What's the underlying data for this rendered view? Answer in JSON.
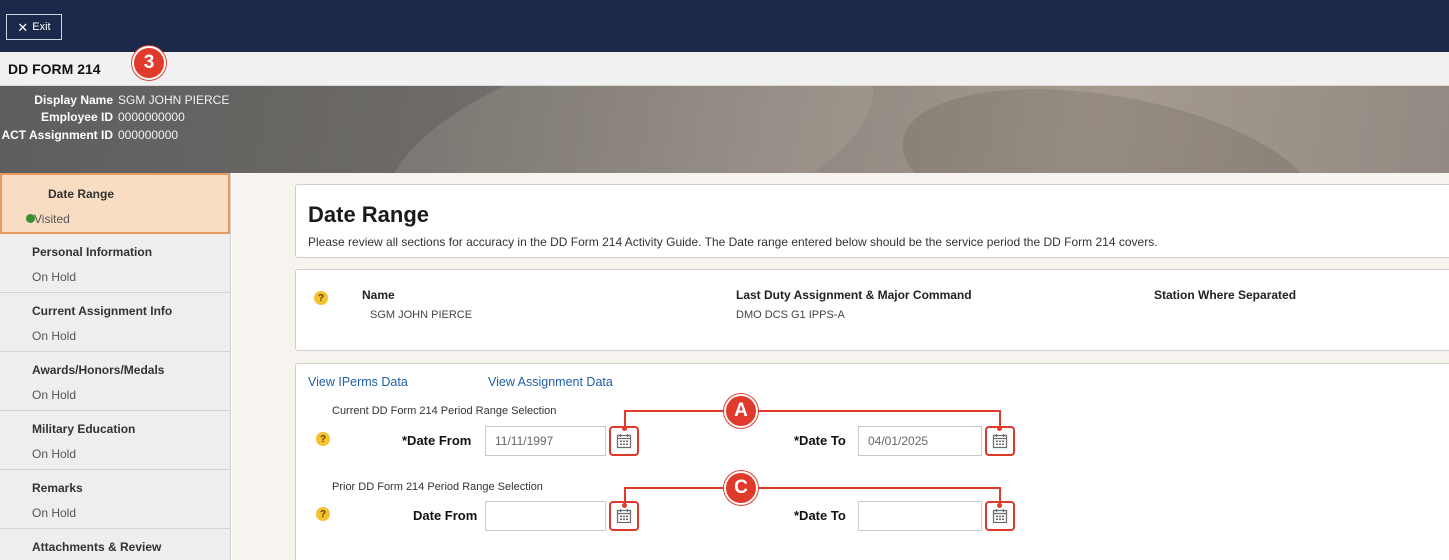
{
  "topbar": {
    "exit_label": "Exit"
  },
  "header": {
    "form_title": "DD FORM 214"
  },
  "callouts": {
    "step": "3",
    "a": "A",
    "c": "C"
  },
  "banner": {
    "display_name_label": "Display Name",
    "display_name_value": "SGM JOHN PIERCE",
    "employee_id_label": "Employee ID",
    "employee_id_value": "0000000000",
    "assignment_id_label": "ACT Assignment ID",
    "assignment_id_value": "000000000"
  },
  "sidebar": {
    "items": [
      {
        "title": "Date Range",
        "status": "Visited"
      },
      {
        "title": "Personal Information",
        "status": "On Hold"
      },
      {
        "title": "Current Assignment Info",
        "status": "On Hold"
      },
      {
        "title": "Awards/Honors/Medals",
        "status": "On Hold"
      },
      {
        "title": "Military Education",
        "status": "On Hold"
      },
      {
        "title": "Remarks",
        "status": "On Hold"
      },
      {
        "title": "Attachments & Review",
        "status": ""
      }
    ]
  },
  "main": {
    "heading": "Date Range",
    "description": "Please review all sections for accuracy in the DD Form 214 Activity Guide. The Date range entered below should be the service period the DD Form 214 covers.",
    "summary": {
      "help": "?",
      "name_header": "Name",
      "name_value": "SGM JOHN PIERCE",
      "duty_header": "Last Duty Assignment & Major Command",
      "duty_value": "DMO DCS G1 IPPS-A",
      "station_header": "Station Where Separated",
      "station_value": ""
    },
    "links": {
      "iperms": "View IPerms Data",
      "assignment": "View Assignment Data"
    },
    "current_period": {
      "section_label": "Current DD Form 214 Period Range Selection",
      "help": "?",
      "date_from_label": "*Date From",
      "date_from_value": "11/11/1997",
      "date_to_label": "*Date To",
      "date_to_value": "04/01/2025"
    },
    "prior_period": {
      "section_label": "Prior DD Form 214 Period Range Selection",
      "help": "?",
      "date_from_label": "Date From",
      "date_from_value": "",
      "date_to_label": "*Date To",
      "date_to_value": ""
    }
  },
  "colors": {
    "topbar": "#1b2a4a",
    "callout": "#e03a2c",
    "active_step_bg": "#f8ddc2",
    "active_step_border": "#e59b5e",
    "link": "#1f5fa8",
    "visited_dot": "#3a8f2f",
    "help_icon": "#f5c12e"
  }
}
